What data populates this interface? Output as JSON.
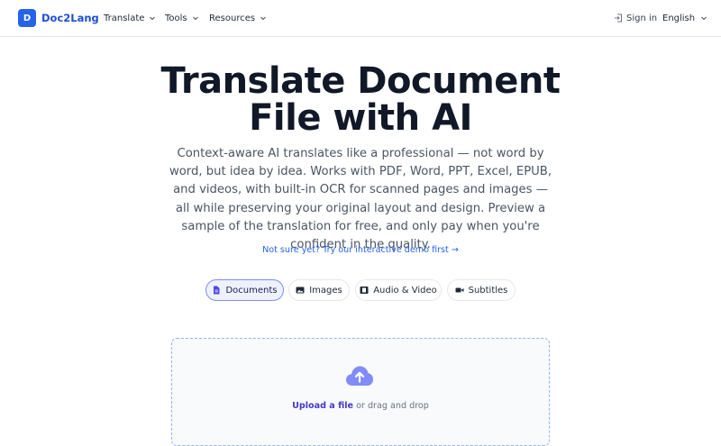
{
  "header": {
    "logo_letter": "D",
    "brand": "Doc2Lang",
    "nav": [
      {
        "label": "Translate"
      },
      {
        "label": "Tools"
      },
      {
        "label": "Resources"
      }
    ],
    "sign_in": "Sign in",
    "language": "English"
  },
  "hero": {
    "title_line1": "Translate Document",
    "title_line2": "File with AI",
    "subtitle": "Context-aware AI translates like a professional — not word by word, but idea by idea. Works with PDF, Word, PPT, Excel, EPUB, and videos, with built-in OCR for scanned pages and images — all while preserving your original layout and design. Preview a sample of the translation for free, and only pay when you're confident in the quality.",
    "demo_link": "Not sure yet? Try our interactive demo first →"
  },
  "tabs": [
    {
      "label": "Documents",
      "icon": "document-icon",
      "active": true
    },
    {
      "label": "Images",
      "icon": "image-icon",
      "active": false
    },
    {
      "label": "Audio & Video",
      "icon": "film-icon",
      "active": false
    },
    {
      "label": "Subtitles",
      "icon": "video-camera-icon",
      "active": false
    }
  ],
  "dropzone": {
    "icon": "cloud-upload-icon",
    "upload_link": "Upload a file",
    "drag_text": " or drag and drop"
  },
  "colors": {
    "accent": "#2563eb",
    "tab_active_bg": "#eef2ff",
    "upload_icon": "#818cf8"
  }
}
